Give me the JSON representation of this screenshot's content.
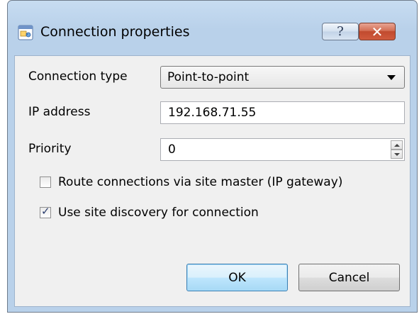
{
  "dialog": {
    "title": "Connection properties",
    "title_icon": "connection-properties-icon",
    "help_button_glyph": "?",
    "close_button_glyph": "✕"
  },
  "form": {
    "connection_type_label": "Connection type",
    "connection_type_value": "Point-to-point",
    "ip_address_label": "IP address",
    "ip_address_value": "192.168.71.55",
    "priority_label": "Priority",
    "priority_value": "0",
    "route_via_master_label": "Route connections via site master (IP gateway)",
    "route_via_master_checked": false,
    "site_discovery_label": "Use site discovery for connection",
    "site_discovery_checked": true
  },
  "buttons": {
    "ok_label": "OK",
    "cancel_label": "Cancel"
  },
  "colors": {
    "frame_blue": "#b9d1ea",
    "close_red": "#c14a2e",
    "client_gray": "#f0f0f0",
    "ok_blue": "#bee6fd"
  }
}
